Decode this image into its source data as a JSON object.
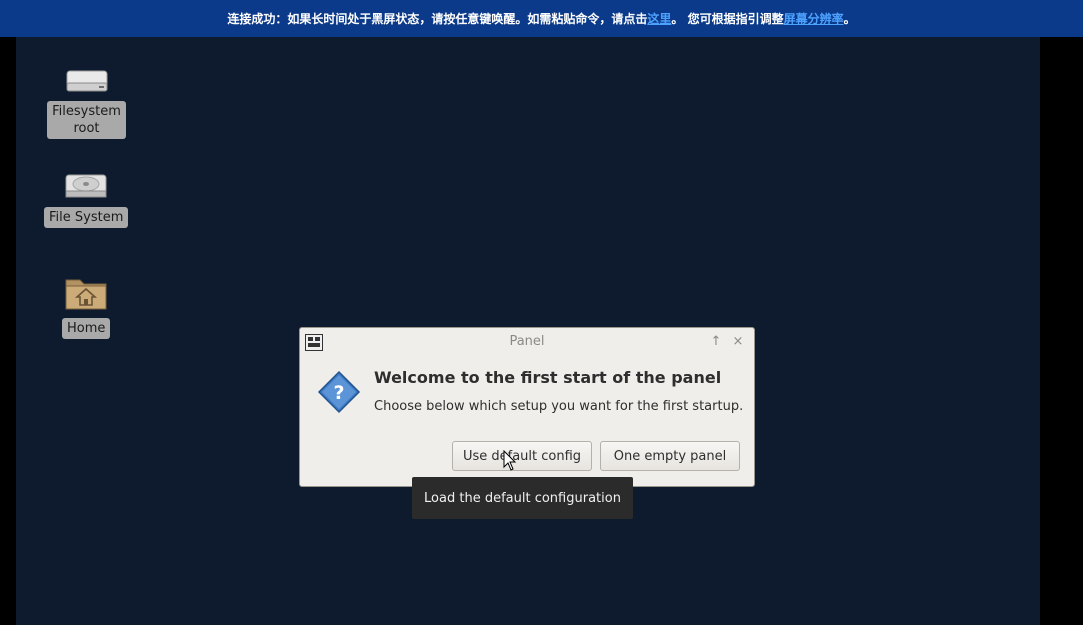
{
  "banner": {
    "text_before": "连接成功：如果长时间处于黑屏状态，请按任意键唤醒。如需粘贴命令，请点击",
    "link1": "这里",
    "text_middle": "。 您可根据指引调整",
    "link2": "屏幕分辨率",
    "text_after": "。",
    "bg_color": "#0b3a8a",
    "link_color": "#4ea2ff"
  },
  "desktop": {
    "bg_color": "#0e1b2f",
    "icons": [
      {
        "label_line1": "Filesystem",
        "label_line2": "root",
        "icon": "drive-icon"
      },
      {
        "label": "File System",
        "icon": "harddisk-icon"
      },
      {
        "label": "Home",
        "icon": "home-folder-icon"
      }
    ]
  },
  "dialog": {
    "title": "Panel",
    "heading": "Welcome to the first start of the panel",
    "subtext": "Choose below which setup you want for the first startup.",
    "buttons": {
      "default": "Use default config",
      "empty": "One empty panel"
    },
    "title_buttons": {
      "pin": "↑",
      "close": "×"
    }
  },
  "tooltip": {
    "text": "Load the default configuration"
  }
}
